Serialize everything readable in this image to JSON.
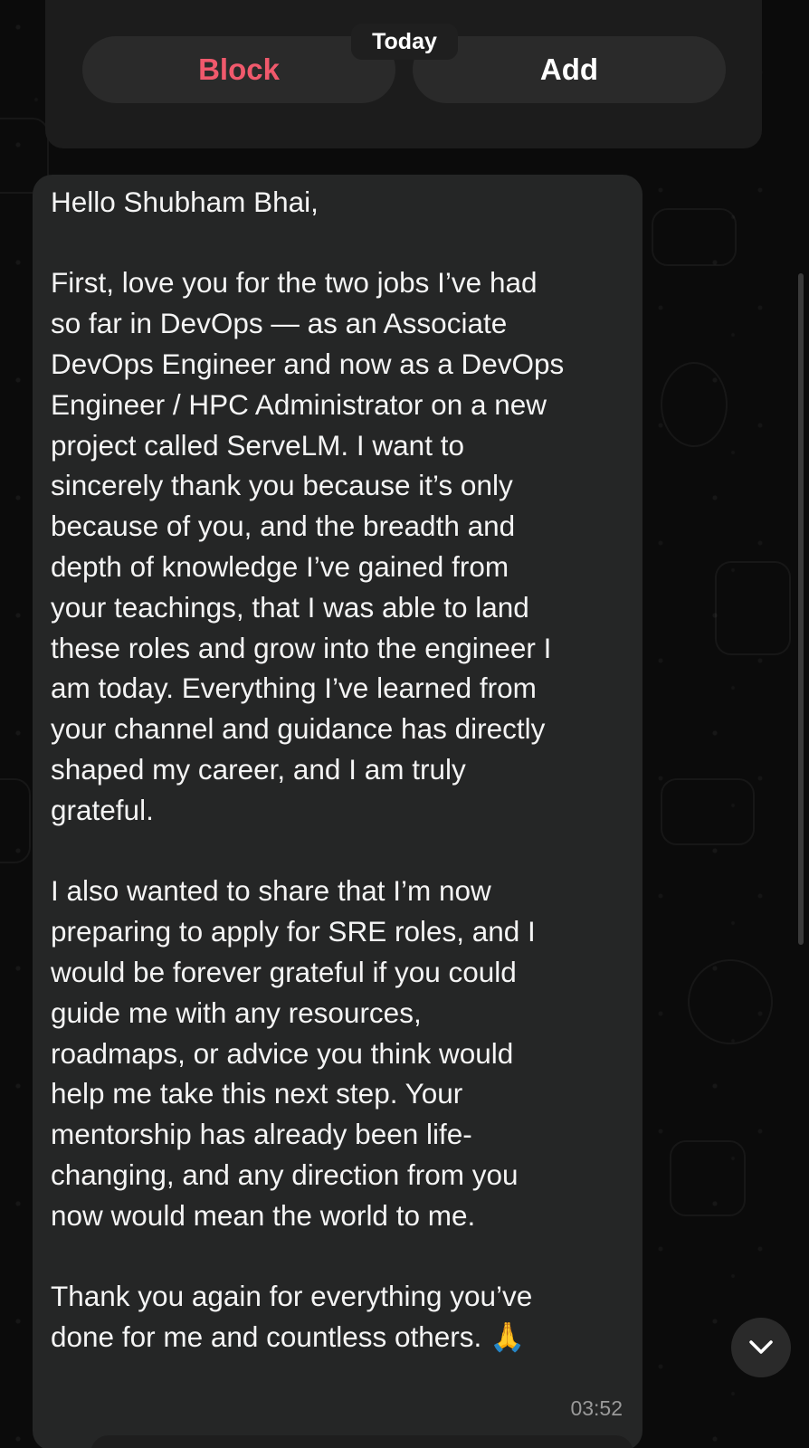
{
  "banner": {
    "block_label": "Block",
    "add_label": "Add",
    "date_label": "Today"
  },
  "message": {
    "lines": [
      "Hello Shubham Bhai,",
      "",
      "First, love you for the two jobs I’ve had",
      "so far in DevOps — as an Associate",
      "DevOps Engineer and now as a DevOps",
      "Engineer / HPC Administrator on a new",
      "project called ServeLM. I want to",
      "sincerely thank you because it’s only",
      "because of you, and the breadth and",
      "depth of knowledge I’ve gained from",
      "your teachings, that I was able to land",
      "these roles and grow into the engineer I",
      "am today. Everything I’ve learned from",
      "your channel and guidance has directly",
      "shaped my career, and I am truly",
      "grateful.",
      "",
      "I also wanted to share that I’m now",
      "preparing to apply for SRE roles, and I",
      "would be forever grateful if you could",
      "guide me with any resources,",
      "roadmaps, or advice you think would",
      "help me take this next step. Your",
      "mentorship has already been life-",
      "changing, and any direction from you",
      "now would mean the world to me.",
      "",
      "Thank you again for everything you’ve",
      "done for me and countless others. 🙏"
    ],
    "time": "03:52"
  },
  "icons": {
    "scroll_down": "chevron-down-icon"
  },
  "colors": {
    "block_red": "#f0596c",
    "bubble_bg": "#252626",
    "background": "#0b0b0b"
  }
}
